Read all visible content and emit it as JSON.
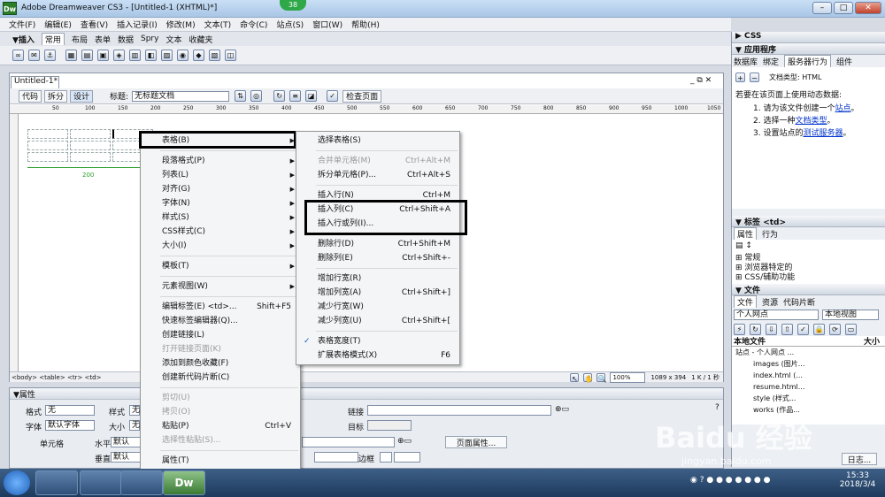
{
  "window": {
    "app_icon": "Dw",
    "title": "Adobe Dreamweaver CS3 - [Untitled-1 (XHTML)*]",
    "notif": "38"
  },
  "menubar": [
    "文件(F)",
    "编辑(E)",
    "查看(V)",
    "插入记录(I)",
    "修改(M)",
    "文本(T)",
    "命令(C)",
    "站点(S)",
    "窗口(W)",
    "帮助(H)"
  ],
  "insert_bar": {
    "label": "▼插入",
    "tabs": [
      "常用",
      "布局",
      "表单",
      "数据",
      "Spry",
      "文本",
      "收藏夹"
    ]
  },
  "document": {
    "tab": "Untitled-1*",
    "btn_code": "代码",
    "btn_split": "拆分",
    "btn_design": "设计",
    "title_label": "标题:",
    "title_value": "无标题文档",
    "check_page": "检查页面"
  },
  "ruler": [
    "50",
    "100",
    "150",
    "200",
    "250",
    "300",
    "350",
    "400",
    "450",
    "500",
    "550",
    "600",
    "650",
    "700",
    "750",
    "800",
    "850",
    "900",
    "950",
    "1000",
    "1050"
  ],
  "table_width": "200",
  "status": {
    "tags": "<body> <table> <tr> <td>",
    "zoom": "100%",
    "size": "1089 x 394",
    "speed": "1 K / 1 秒"
  },
  "properties": {
    "title": "▼属性",
    "format_label": "格式",
    "format": "无",
    "style_label": "样式",
    "style": "无",
    "font_label": "字体",
    "font": "默认字体",
    "size_label": "大小",
    "size": "无",
    "cell_label": "单元格",
    "horiz_label": "水平",
    "horiz": "默认",
    "vert_label": "垂直",
    "vert": "默认",
    "link_label": "链接",
    "target_label": "目标",
    "border_label": "边框",
    "page_props": "页面属性..."
  },
  "right_panel": {
    "css": "▶ CSS",
    "app": "▼ 应用程序",
    "app_tabs": [
      "数据库",
      "绑定",
      "服务器行为",
      "组件"
    ],
    "doc_type": "文档类型:  HTML",
    "intro": "若要在该页面上使用动态数据:",
    "steps": [
      {
        "n": "1.",
        "text": "请为该文件创建一个",
        "link": "站点",
        "end": "。"
      },
      {
        "n": "2.",
        "text": "选择一种",
        "link": "文档类型",
        "end": "。"
      },
      {
        "n": "3.",
        "text": "设置站点的",
        "link": "测试服务器",
        "end": "。"
      }
    ],
    "tag_panel": "▼ 标签 <td>",
    "tag_tabs": [
      "属性",
      "行为"
    ],
    "tag_cats": [
      "⊞ 常规",
      "⊞ 浏览器特定的",
      "⊞ CSS/辅助功能",
      "⊞ 语言"
    ],
    "files_panel": "▼ 文件",
    "files_tabs": [
      "文件",
      "资源",
      "代码片断"
    ],
    "site": "个人网点",
    "view": "本地视图",
    "local_files": "本地文件",
    "size_col": "大小",
    "tree": [
      "站点 - 个人网点 ...",
      "images (图片...",
      "index.html (...",
      "resume.html...",
      "style (样式...",
      "works (作品..."
    ],
    "log": "日志..."
  },
  "context_menu": [
    {
      "label": "表格(B)",
      "arrow": true
    },
    {
      "sep": true
    },
    {
      "label": "段落格式(P)",
      "arrow": true
    },
    {
      "label": "列表(L)",
      "arrow": true
    },
    {
      "label": "对齐(G)",
      "arrow": true
    },
    {
      "label": "字体(N)",
      "arrow": true
    },
    {
      "label": "样式(S)",
      "arrow": true
    },
    {
      "label": "CSS样式(C)",
      "arrow": true
    },
    {
      "label": "大小(I)",
      "arrow": true
    },
    {
      "sep": true
    },
    {
      "label": "模板(T)",
      "arrow": true
    },
    {
      "sep": true
    },
    {
      "label": "元素视图(W)",
      "arrow": true
    },
    {
      "sep": true
    },
    {
      "label": "编辑标签(E) <td>...",
      "shortcut": "Shift+F5"
    },
    {
      "label": "快速标签编辑器(Q)..."
    },
    {
      "label": "创建链接(L)"
    },
    {
      "label": "打开链接页面(K)",
      "disabled": true
    },
    {
      "label": "添加到颜色收藏(F)"
    },
    {
      "label": "创建新代码片断(C)"
    },
    {
      "sep": true
    },
    {
      "label": "剪切(U)",
      "disabled": true
    },
    {
      "label": "拷贝(O)",
      "disabled": true
    },
    {
      "label": "粘贴(P)",
      "shortcut": "Ctrl+V"
    },
    {
      "label": "选择性粘贴(S)...",
      "disabled": true
    },
    {
      "sep": true
    },
    {
      "label": "属性(T)"
    }
  ],
  "submenu": [
    {
      "label": "选择表格(S)"
    },
    {
      "sep": true
    },
    {
      "label": "合并单元格(M)",
      "shortcut": "Ctrl+Alt+M",
      "disabled": true
    },
    {
      "label": "拆分单元格(P)...",
      "shortcut": "Ctrl+Alt+S"
    },
    {
      "sep": true
    },
    {
      "label": "插入行(N)",
      "shortcut": "Ctrl+M"
    },
    {
      "label": "插入列(C)",
      "shortcut": "Ctrl+Shift+A"
    },
    {
      "label": "插入行或列(I)..."
    },
    {
      "sep": true
    },
    {
      "label": "删除行(D)",
      "shortcut": "Ctrl+Shift+M"
    },
    {
      "label": "删除列(E)",
      "shortcut": "Ctrl+Shift+-"
    },
    {
      "sep": true
    },
    {
      "label": "增加行宽(R)"
    },
    {
      "label": "增加列宽(A)",
      "shortcut": "Ctrl+Shift+]"
    },
    {
      "label": "减少行宽(W)"
    },
    {
      "label": "减少列宽(U)",
      "shortcut": "Ctrl+Shift+["
    },
    {
      "sep": true
    },
    {
      "label": "表格宽度(T)",
      "checked": true
    },
    {
      "label": "扩展表格模式(X)",
      "shortcut": "F6"
    }
  ],
  "taskbar": {
    "dw": "Dw",
    "time": "15:33",
    "date": "2018/3/4"
  },
  "watermark": "Baidu 经验",
  "watermark_url": "jingyan.baidu.com"
}
